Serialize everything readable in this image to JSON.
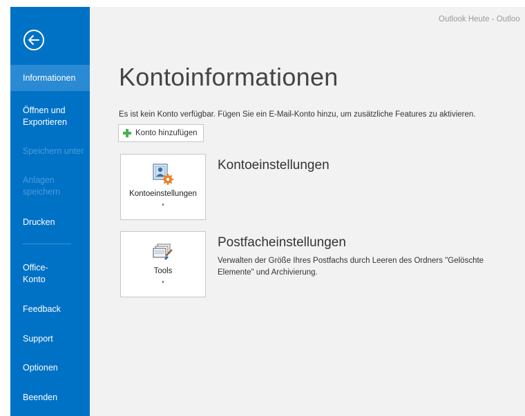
{
  "window": {
    "title": "Outlook Heute - Outloo"
  },
  "sidebar": {
    "back_icon": "arrow-left-circle-icon",
    "items": [
      {
        "label": "Informationen",
        "state": "active"
      },
      {
        "label": "Öffnen und\nExportieren",
        "state": "normal"
      },
      {
        "label": "Speichern unter",
        "state": "disabled"
      },
      {
        "label": "Anlagen\nspeichern",
        "state": "disabled"
      },
      {
        "label": "Drucken",
        "state": "normal"
      },
      {
        "label": "Office-\nKonto",
        "state": "normal"
      },
      {
        "label": "Feedback",
        "state": "normal"
      },
      {
        "label": "Support",
        "state": "normal"
      },
      {
        "label": "Optionen",
        "state": "normal"
      },
      {
        "label": "Beenden",
        "state": "normal"
      }
    ]
  },
  "main": {
    "title": "Kontoinformationen",
    "info_text": "Es ist kein Konto verfügbar. Fügen Sie ein E-Mail-Konto hinzu, um zusätzliche Features zu aktivieren.",
    "add_account_label": "Konto hinzufügen",
    "add_account_icon": "plus-icon",
    "sections": [
      {
        "tile_label": "Kontoeinstellungen",
        "tile_icon": "account-settings-icon",
        "caret": "▾",
        "title": "Kontoeinstellungen",
        "description": ""
      },
      {
        "tile_label": "Tools",
        "tile_icon": "tools-icon",
        "caret": "▾",
        "title": "Postfacheinstellungen",
        "description": "Verwalten der Größe Ihres Postfachs durch Leeren des Ordners \"Gelöschte Elemente\" und Archivierung."
      }
    ]
  },
  "colors": {
    "sidebar_bg": "#0072c6",
    "sidebar_active": "#2a8ad4",
    "sidebar_disabled_text": "#4a9ad9",
    "main_bg": "#f2f2f2",
    "plus_icon": "#4caf50"
  }
}
